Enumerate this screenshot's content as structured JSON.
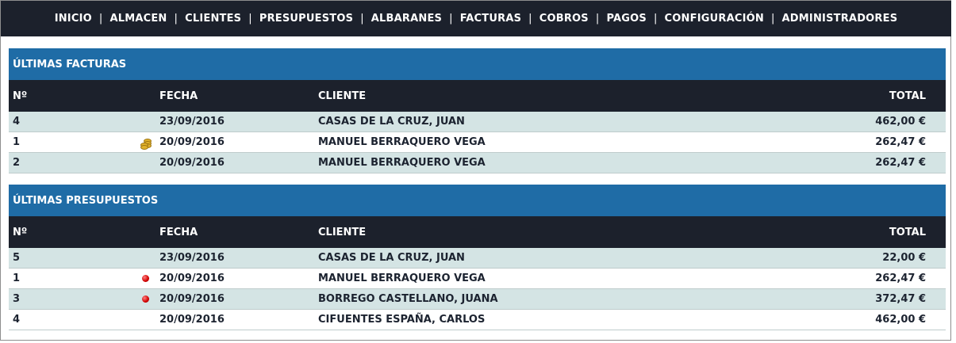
{
  "nav": {
    "items": [
      "INICIO",
      "ALMACEN",
      "CLIENTES",
      "PRESUPUESTOS",
      "ALBARANES",
      "FACTURAS",
      "COBROS",
      "PAGOS",
      "CONFIGURACIÓN",
      "ADMINISTRADORES"
    ],
    "separator": "|"
  },
  "facturas": {
    "title": "ÚLTIMAS FACTURAS",
    "headers": {
      "n": "Nº",
      "fecha": "FECHA",
      "cliente": "CLIENTE",
      "total": "TOTAL"
    },
    "rows": [
      {
        "n": "4",
        "icon": "",
        "fecha": "23/09/2016",
        "cliente": "CASAS DE LA CRUZ, JUAN",
        "total": "462,00 €"
      },
      {
        "n": "1",
        "icon": "coins-icon",
        "fecha": "20/09/2016",
        "cliente": "MANUEL BERRAQUERO VEGA",
        "total": "262,47 €"
      },
      {
        "n": "2",
        "icon": "",
        "fecha": "20/09/2016",
        "cliente": "MANUEL BERRAQUERO VEGA",
        "total": "262,47 €"
      }
    ]
  },
  "presupuestos": {
    "title": "ÚLTIMAS PRESUPUESTOS",
    "headers": {
      "n": "Nº",
      "fecha": "FECHA",
      "cliente": "CLIENTE",
      "total": "TOTAL"
    },
    "rows": [
      {
        "n": "5",
        "icon": "",
        "fecha": "23/09/2016",
        "cliente": "CASAS DE LA CRUZ, JUAN",
        "total": "22,00 €"
      },
      {
        "n": "1",
        "icon": "red-dot-icon",
        "fecha": "20/09/2016",
        "cliente": "MANUEL BERRAQUERO VEGA",
        "total": "262,47 €"
      },
      {
        "n": "3",
        "icon": "red-dot-icon",
        "fecha": "20/09/2016",
        "cliente": "BORREGO CASTELLANO, JUANA",
        "total": "372,47 €"
      },
      {
        "n": "4",
        "icon": "",
        "fecha": "20/09/2016",
        "cliente": "CIFUENTES ESPAÑA, CARLOS",
        "total": "462,00 €"
      }
    ]
  },
  "colors": {
    "navbar_bg": "#1c212c",
    "panel_title_bg": "#1f6ca6",
    "row_alt_bg": "#d4e4e4",
    "status_red": "#d10000",
    "coins_gold": "#e0b12c"
  }
}
